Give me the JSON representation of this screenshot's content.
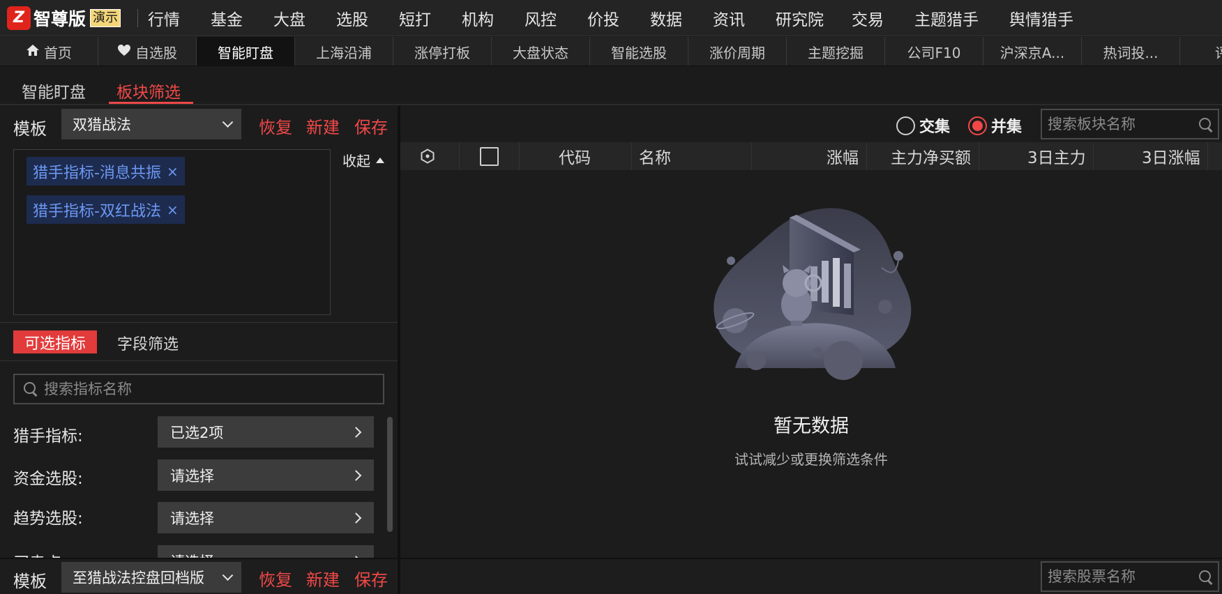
{
  "brand": {
    "logo_glyph": "Z",
    "name": "智尊版",
    "badge": "演示"
  },
  "top_menu": [
    "行情",
    "基金",
    "大盘",
    "选股",
    "短打",
    "机构",
    "风控",
    "价投",
    "数据",
    "资讯",
    "研究院",
    "交易",
    "主题猎手",
    "舆情猎手"
  ],
  "tabs": [
    {
      "label": "首页",
      "icon": "home-icon"
    },
    {
      "label": "自选股",
      "icon": "heart-icon"
    },
    {
      "label": "智能盯盘",
      "active": true
    },
    {
      "label": "上海沿浦"
    },
    {
      "label": "涨停打板"
    },
    {
      "label": "大盘状态"
    },
    {
      "label": "智能选股"
    },
    {
      "label": "涨价周期"
    },
    {
      "label": "主题挖掘"
    },
    {
      "label": "公司F10"
    },
    {
      "label": "沪深京A..."
    },
    {
      "label": "热词投..."
    },
    {
      "label": "评级"
    }
  ],
  "subtabs": {
    "smart_watch": "智能盯盘",
    "sector_filter": "板块筛选"
  },
  "left": {
    "template_label": "模板",
    "template_value": "双猎战法",
    "actions": {
      "restore": "恢复",
      "new": "新建",
      "save": "保存"
    },
    "tags": [
      "猎手指标-消息共振",
      "猎手指标-双红战法"
    ],
    "tag_close": "×",
    "collapse": "收起",
    "tab_indicators": "可选指标",
    "tab_fields": "字段筛选",
    "search_placeholder": "搜索指标名称",
    "filters": [
      {
        "label": "猎手指标:",
        "value": "已选2项"
      },
      {
        "label": "资金选股:",
        "value": "请选择"
      },
      {
        "label": "趋势选股:",
        "value": "请选择"
      },
      {
        "label": "买卖点:",
        "value": "请选择"
      }
    ]
  },
  "right": {
    "radio_intersection": "交集",
    "radio_union": "并集",
    "selected_mode": "并集",
    "search_placeholder": "搜索板块名称",
    "columns": {
      "code": "代码",
      "name": "名称",
      "change": "涨幅",
      "net_buy": "主力净买额",
      "main_3d": "3日主力",
      "change_3d": "3日涨幅"
    },
    "empty_title": "暂无数据",
    "empty_subtitle": "试试减少或更换筛选条件"
  },
  "bottom": {
    "template_label": "模板",
    "template_value": "至猎战法控盘回档版",
    "actions": {
      "restore": "恢复",
      "new": "新建",
      "save": "保存"
    },
    "search_placeholder": "搜索股票名称"
  },
  "colors": {
    "accent_red": "#f04848",
    "tag_bg": "#1d2b4f",
    "tag_text": "#6d98f2",
    "background": "#1a1a1a"
  }
}
